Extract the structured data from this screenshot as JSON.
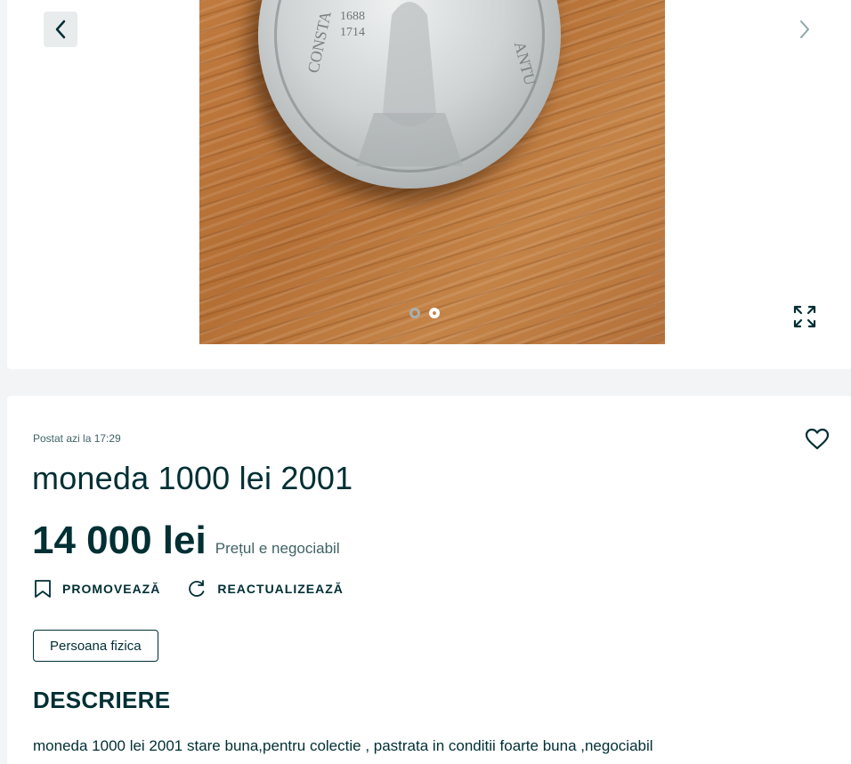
{
  "gallery": {
    "prev_icon": "chevron-left-icon",
    "next_icon": "chevron-right-icon",
    "expand_icon": "expand-icon",
    "image_count": 2,
    "active_index": 1,
    "coin_text": [
      "1688",
      "1714",
      "CONSTA",
      "ANTU"
    ]
  },
  "listing": {
    "posted": "Postat azi la 17:29",
    "title": "moneda 1000 lei 2001",
    "price": "14 000 lei",
    "negotiable": "Prețul e negociabil",
    "favorite_icon": "heart-icon",
    "actions": [
      {
        "label": "PROMOVEAZĂ",
        "icon": "bookmark-icon"
      },
      {
        "label": "REACTUALIZEAZĂ",
        "icon": "refresh-icon"
      }
    ],
    "seller_type": "Persoana fizica",
    "description_heading": "DESCRIERE",
    "description": "moneda 1000 lei 2001 stare buna,pentru colectie , pastrata in conditii foarte buna ,negociabil"
  },
  "colors": {
    "primary_text": "#002f34",
    "background": "#f2f4f5",
    "card": "#ffffff"
  }
}
